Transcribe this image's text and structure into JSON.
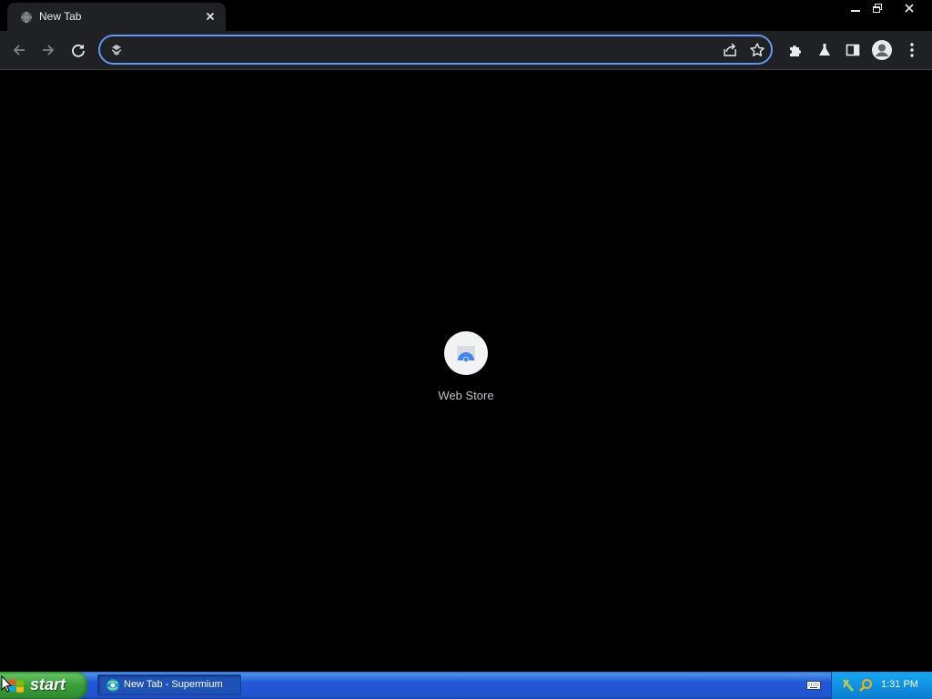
{
  "browser": {
    "tab": {
      "title": "New Tab",
      "favicon": "globe-icon",
      "close": "close-icon"
    },
    "window_controls": [
      "minimize-icon",
      "restore-icon",
      "close-icon"
    ],
    "toolbar": {
      "back": "back-arrow-icon",
      "forward": "forward-arrow-icon",
      "reload": "reload-icon",
      "address_value": "",
      "address_icon": "search-engine-icon",
      "share": "share-icon",
      "bookmark": "star-icon",
      "extensions": "puzzle-icon",
      "labs": "flask-icon",
      "side_panel": "side-panel-icon",
      "profile": "profile-avatar-icon",
      "menu": "kebab-menu-icon"
    },
    "accent_color": "#5e97f6"
  },
  "new_tab_page": {
    "shortcuts": [
      {
        "label": "Web Store",
        "icon": "web-store-icon"
      }
    ]
  },
  "taskbar": {
    "start_label": "start",
    "tasks": [
      {
        "label": "New Tab - Supermium",
        "icon": "supermium-icon"
      }
    ],
    "tray_icons": [
      "keyboard-icon",
      "network-icon",
      "search-icon"
    ],
    "clock": "1:31 PM"
  }
}
